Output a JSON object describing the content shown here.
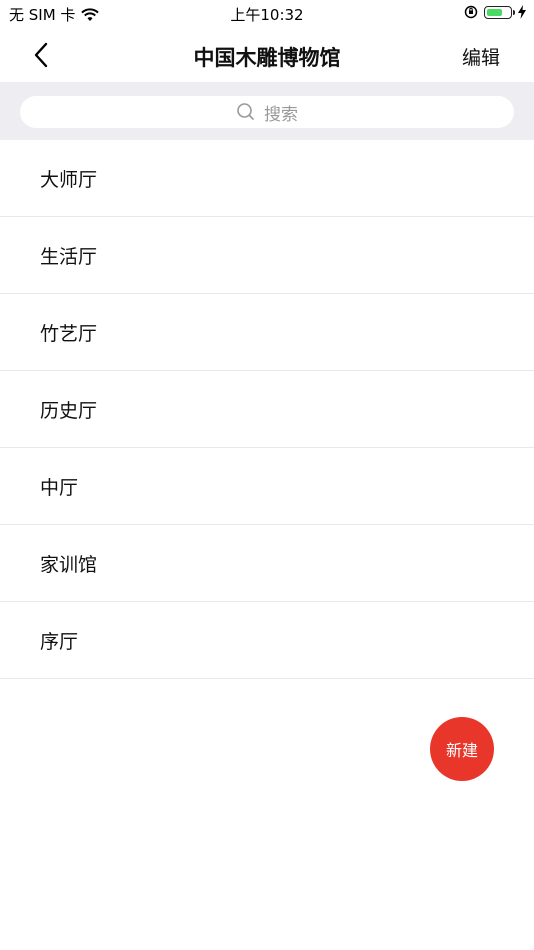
{
  "status_bar": {
    "carrier": "无 SIM 卡",
    "time": "上午10:32",
    "battery_level": 0.7
  },
  "header": {
    "title": "中国木雕博物馆",
    "edit_label": "编辑",
    "back_icon": "chevron-left-icon"
  },
  "search": {
    "placeholder": "搜索"
  },
  "halls": [
    {
      "name": "大师厅"
    },
    {
      "name": "生活厅"
    },
    {
      "name": "竹艺厅"
    },
    {
      "name": "历史厅"
    },
    {
      "name": "中厅"
    },
    {
      "name": "家训馆"
    },
    {
      "name": "序厅"
    }
  ],
  "fab": {
    "label": "新建",
    "color": "#e8372a"
  }
}
